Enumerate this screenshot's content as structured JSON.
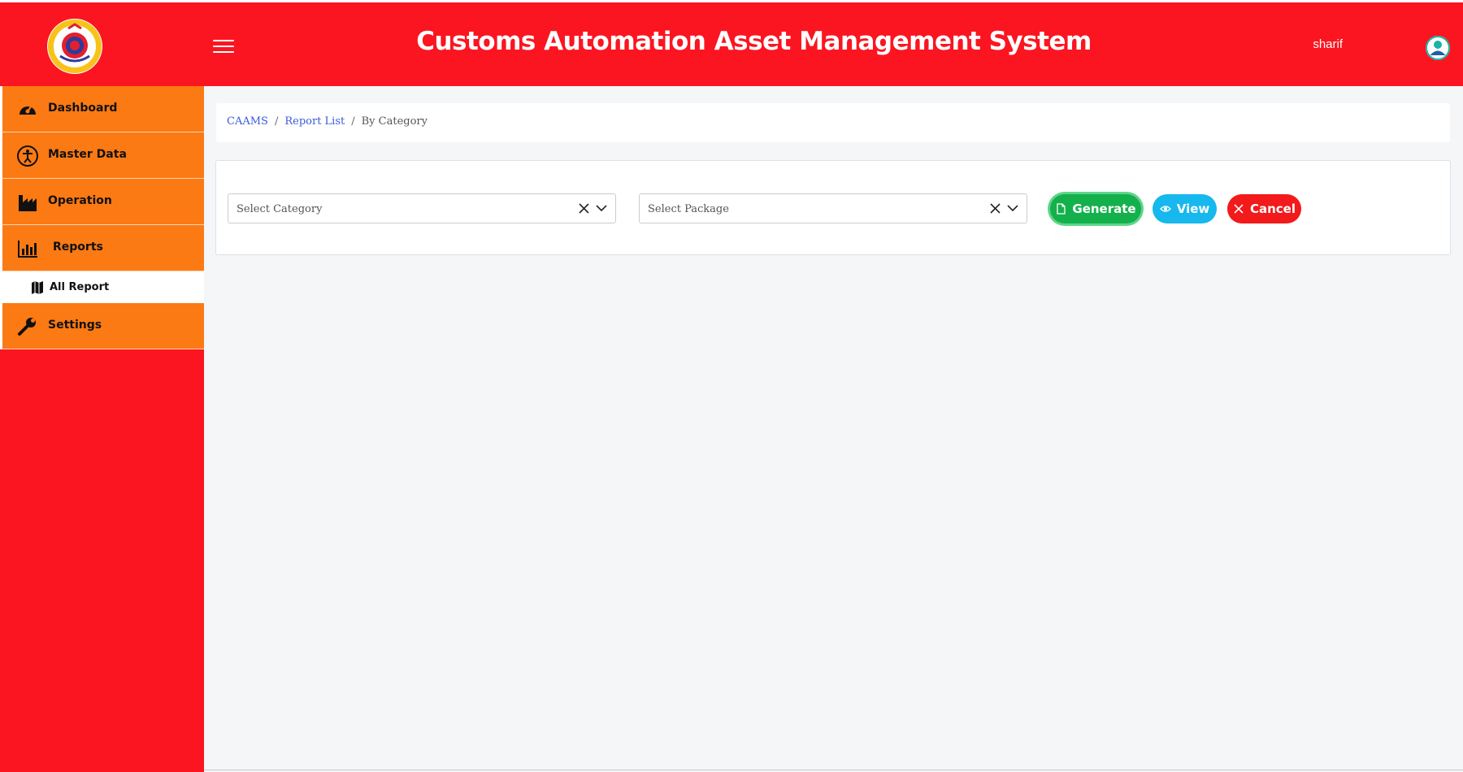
{
  "header": {
    "title": "Customs Automation Asset Management System",
    "username": "sharif",
    "logo_text": "BANGLADESH CUSTOMS & VAT",
    "background_color": "#fb1520"
  },
  "sidebar": {
    "items": [
      {
        "label": "Dashboard",
        "icon": "dashboard-gauge-icon"
      },
      {
        "label": "Master Data",
        "icon": "universal-access-icon"
      },
      {
        "label": "Operation",
        "icon": "factory-icon"
      },
      {
        "label": "Reports",
        "icon": "bar-chart-icon"
      }
    ],
    "sub_item": {
      "label": "All Report",
      "icon": "map-icon",
      "active": true
    },
    "settings": {
      "label": "Settings",
      "icon": "wrench-icon"
    },
    "item_color": "#fb7a14"
  },
  "breadcrumb": {
    "root": "CAAMS",
    "level1": "Report List",
    "current": "By Category",
    "separator": "/"
  },
  "filters": {
    "category_placeholder": "Select Category",
    "package_placeholder": "Select Package"
  },
  "buttons": {
    "generate": "Generate",
    "view": "View",
    "cancel": "Cancel"
  }
}
